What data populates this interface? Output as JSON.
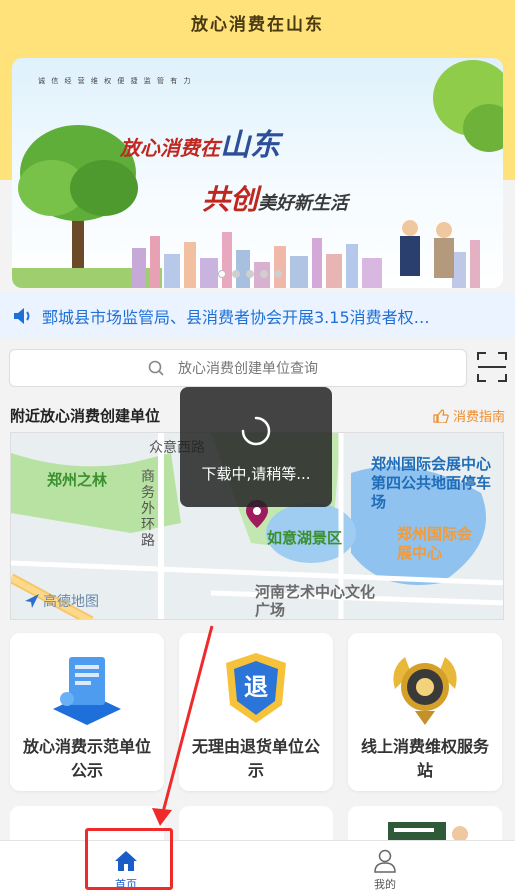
{
  "header": {
    "title": "放心消费在山东"
  },
  "banner": {
    "slogan": "诚 信 经 营   维 权 便 捷   监 管 有 力",
    "headline_small": "放心消费在",
    "headline_big": "山东",
    "subline_big": "共创",
    "subline_small": "美好新生活",
    "slide_count": 5,
    "active_slide": 1
  },
  "notice": {
    "text": "鄄城县市场监管局、县消费者协会开展3.15消费者权…"
  },
  "search": {
    "placeholder": "放心消费创建单位查询"
  },
  "nearby": {
    "title": "附近放心消费创建单位",
    "guide_label": "消费指南"
  },
  "map": {
    "labels": {
      "road_1": "众意西路",
      "area_1": "郑州之林",
      "road_2": "商务外环路",
      "lake": "如意湖景区",
      "expo_parking": "郑州国际会展中心第四公共地面停车场",
      "expo_center": "郑州国际会展中心",
      "art_center": "河南艺术中心文化广场"
    },
    "logo": "高德地图"
  },
  "toast": {
    "text": "下载中,请稍等..."
  },
  "cards": [
    {
      "label": "放心消费示范单位公示"
    },
    {
      "label": "无理由退货单位公示"
    },
    {
      "label": "线上消费维权服务站"
    }
  ],
  "tabbar": {
    "tabs": [
      {
        "label": "首页",
        "active": true
      },
      {
        "label": "我的",
        "active": false
      }
    ]
  },
  "colors": {
    "header_bg": "#ffe27a",
    "accent_blue": "#1a5dc8",
    "highlight_red": "#ef2a2a"
  }
}
